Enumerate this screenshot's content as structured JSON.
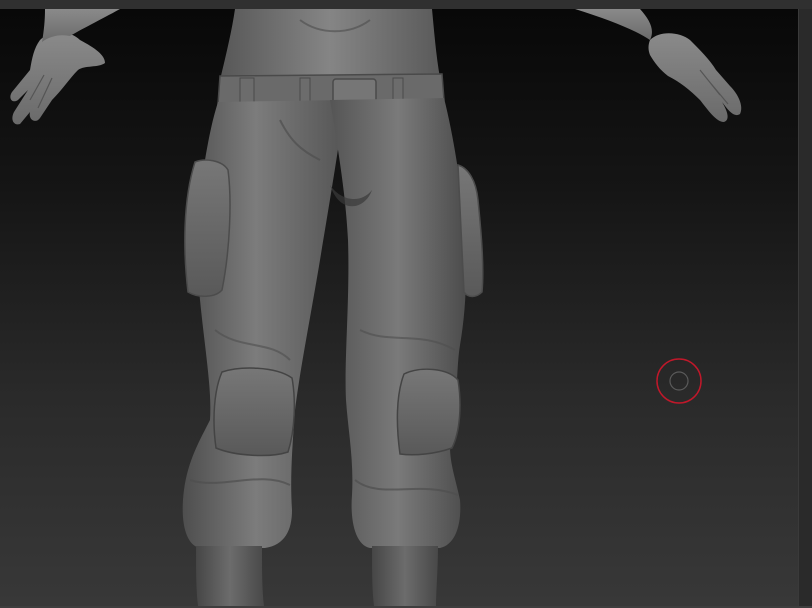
{
  "viewport": {
    "background_top": "#080808",
    "background_bottom": "#383838"
  },
  "model": {
    "material_color": "#6e6e6e",
    "highlight_color": "#8a8a8a",
    "shadow_color": "#4a4a4a"
  },
  "brush_cursor": {
    "color": "#c0182a",
    "icon": "circle-brush-cursor"
  }
}
